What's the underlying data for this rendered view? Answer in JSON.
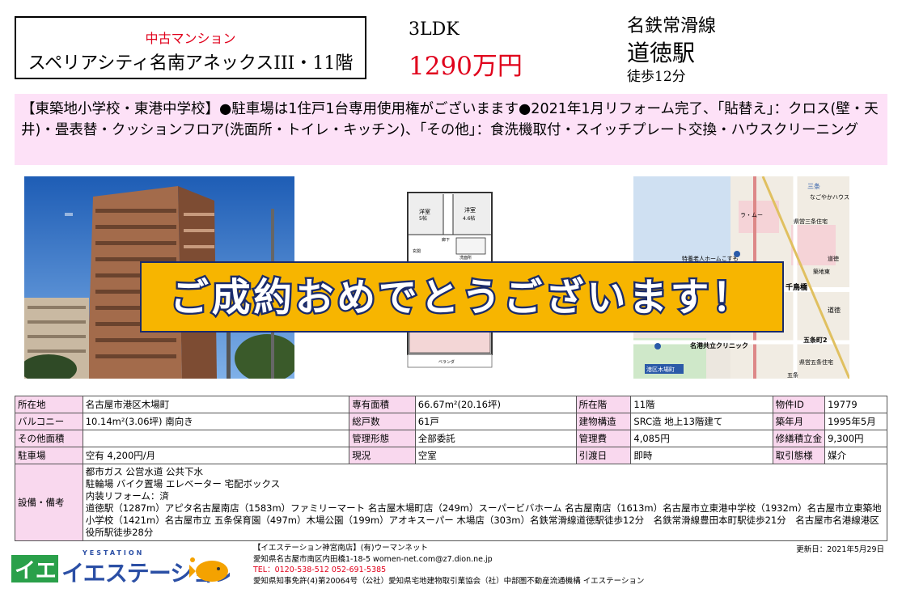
{
  "header": {
    "category": "中古マンション",
    "property_name": "スペリアシティ名南アネックスIII・11階",
    "layout": "3LDK",
    "price": "1290万円",
    "line": "名鉄常滑線",
    "station": "道徳駅",
    "walk": "徒歩12分"
  },
  "notice": "【東築地小学校・東港中学校】●駐車場は1住戸1台専用使用権がございまます●2021年1月リフォーム完了、「貼替え」：クロス(壁・天井)・畳表替・クッションフロア(洗面所・トイレ・キッチン)、「その他」：食洗機取付・スイッチプレート交換・ハウスクリーニング",
  "banner": "ご成約おめでとうございます！",
  "floorplan": {
    "room1": "洋室",
    "room1_size": "5帖",
    "room2": "洋室",
    "room2_size": "4.6帖",
    "hall": "廊下",
    "entrance": "玄関",
    "washroom": "洗面所",
    "balcony": "ベランダ"
  },
  "map": {
    "labels": [
      "三条",
      "なごやかハウス",
      "ラ・ムー",
      "県営三条住宅",
      "特養老人ホームこすも",
      "道徳",
      "築地東",
      "千鳥橋",
      "道徳",
      "五条町2",
      "名港共立クリニック",
      "港区木場町",
      "県営五条住宅",
      "五条"
    ]
  },
  "table": {
    "rows": [
      [
        {
          "label": "所在地",
          "value": "名古屋市港区木場町"
        },
        {
          "label": "専有面積",
          "value": "66.67m²(20.16坪)"
        },
        {
          "label": "所在階",
          "value": "11階"
        },
        {
          "label": "物件ID",
          "value": "19779"
        }
      ],
      [
        {
          "label": "バルコニー",
          "value": "10.14m²(3.06坪) 南向き"
        },
        {
          "label": "総戸数",
          "value": "61戸"
        },
        {
          "label": "建物構造",
          "value": "SRC造 地上13階建て"
        },
        {
          "label": "築年月",
          "value": "1995年5月"
        }
      ],
      [
        {
          "label": "その他面積",
          "value": ""
        },
        {
          "label": "管理形態",
          "value": "全部委託"
        },
        {
          "label": "管理費",
          "value": "4,085円"
        },
        {
          "label": "修繕積立金",
          "value": "9,300円"
        }
      ],
      [
        {
          "label": "駐車場",
          "value": "空有 4,200円/月"
        },
        {
          "label": "現況",
          "value": "空室"
        },
        {
          "label": "引渡日",
          "value": "即時"
        },
        {
          "label": "取引態様",
          "value": "媒介"
        }
      ]
    ],
    "equipment_label": "設備・備考",
    "equipment_lines": [
      "都市ガス 公営水道 公共下水",
      "駐輪場 バイク置場 エレベーター 宅配ボックス",
      "内装リフォーム：済",
      "道徳駅（1287m）アピタ名古屋南店（1583m）ファミリーマート 名古屋木場町店（249m）スーパービバホーム 名古屋南店（1613m）名古屋市立東港中学校（1932m）名古屋市立東築地小学校（1421m）名古屋市立 五条保育園（497m）木場公園（199m）アオキスーパー 木場店（303m）名鉄常滑線道徳駅徒歩12分　名鉄常滑線豊田本町駅徒歩21分　名古屋市名港線港区役所駅徒歩28分"
    ]
  },
  "footer": {
    "logo_text": "イエステーション",
    "logo_sub": "YESTATION",
    "company_name": "【イエステーション神宮南店】(有)ウーマンネット",
    "address": "愛知県名古屋市南区内田橋1-18-5 women-net.com@z7.dion.ne.jp",
    "phone": "TEL：0120-538-512 052-691-5385",
    "license": "愛知県知事免許(4)第20064号（公社）愛知県宅地建物取引業協会（社）中部圏不動産流通機構 イエステーション",
    "updated": "更新日：2021年5月29日"
  },
  "colors": {
    "accent_red": "#e0001b",
    "notice_bg": "#fde1f7",
    "label_bg": "#f9d8ee",
    "banner_bg": "#f7b500",
    "banner_stroke": "#1a2b6b"
  }
}
